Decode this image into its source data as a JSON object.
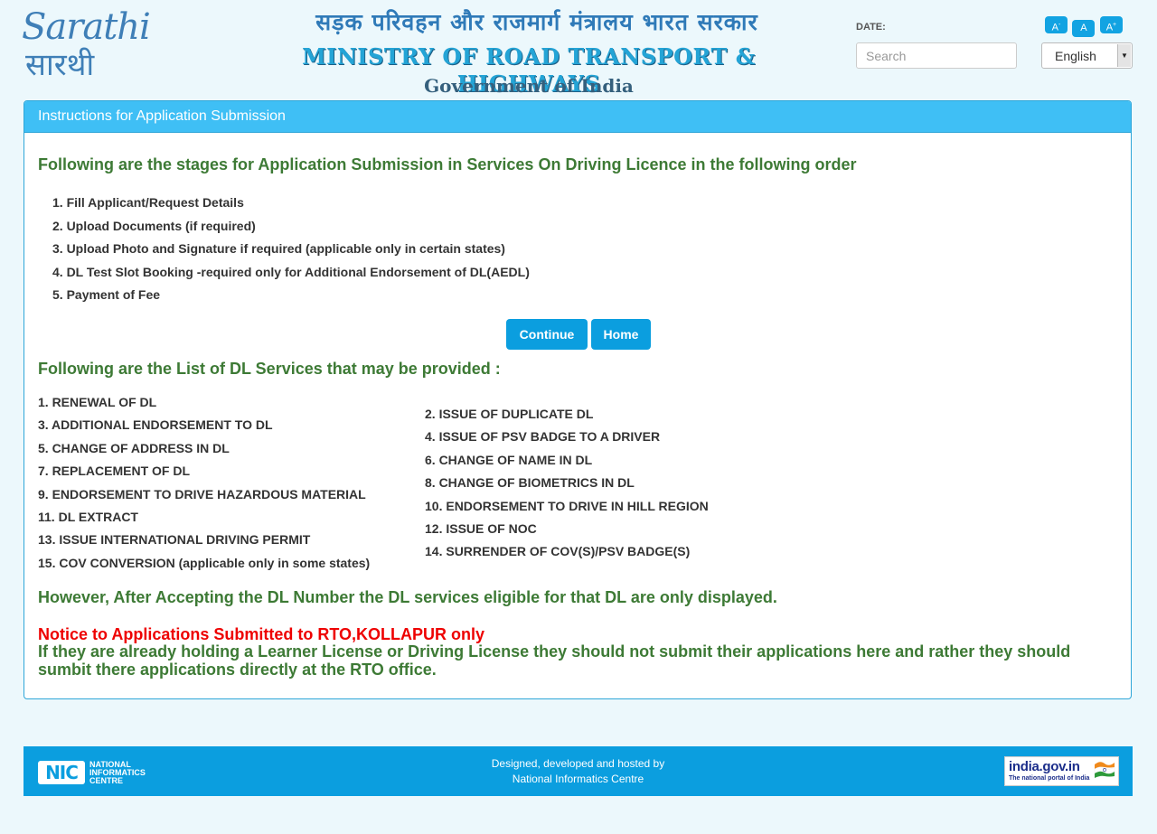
{
  "header": {
    "logo_top": "Sarathi",
    "logo_bottom": "सारथी",
    "ministry_hindi": "सड़क परिवहन और राजमार्ग मंत्रालय भारत सरकार",
    "ministry_english": "MINISTRY OF ROAD TRANSPORT & HIGHWAYS",
    "ministry_gov": "Government of India",
    "date_label": "DATE:",
    "search_placeholder": "Search",
    "font_small": "A-",
    "font_normal": "A",
    "font_large": "A+",
    "language": "English"
  },
  "panel": {
    "title": "Instructions for Application Submission",
    "stages_heading": "Following are the stages for Application Submission in Services On Driving Licence in the following order",
    "stages": [
      "1. Fill Applicant/Request Details",
      "2. Upload Documents (if required)",
      "3. Upload Photo and Signature if required (applicable only in certain states)",
      "4. DL Test Slot Booking -required only for Additional Endorsement of DL(AEDL)",
      "5. Payment of Fee"
    ],
    "continue_label": "Continue",
    "home_label": "Home",
    "services_heading": "Following are the List of DL Services that may be provided :",
    "services_left": [
      "1.  RENEWAL OF DL",
      "3.  ADDITIONAL ENDORSEMENT TO DL",
      "5.  CHANGE OF ADDRESS IN DL",
      "7.  REPLACEMENT OF DL",
      "9.  ENDORSEMENT TO DRIVE HAZARDOUS MATERIAL",
      "11. DL EXTRACT",
      "13. ISSUE INTERNATIONAL DRIVING PERMIT",
      "15. COV CONVERSION (applicable only in some states)"
    ],
    "services_right": [
      "2.  ISSUE OF DUPLICATE DL",
      "4.  ISSUE OF PSV BADGE TO A DRIVER",
      "6.  CHANGE OF NAME IN DL",
      "8.  CHANGE OF BIOMETRICS IN DL",
      "10. ENDORSEMENT TO DRIVE IN HILL REGION",
      "12. ISSUE OF NOC",
      "14. SURRENDER OF COV(S)/PSV BADGE(S)"
    ],
    "eligibility_note": "However, After Accepting the DL Number the DL services eligible for that DL are only displayed.",
    "notice_title": "Notice to Applications Submitted to RTO,KOLLAPUR only",
    "notice_body": "If they are already holding a Learner License or Driving License they should not submit their applications here and rather they should sumbit there applications directly at the RTO office."
  },
  "footer": {
    "nic_mark": "NIC",
    "nic_line1": "NATIONAL",
    "nic_line2": "INFORMATICS",
    "nic_line3": "CENTRE",
    "credit_line1": "Designed, developed and hosted by",
    "credit_line2": "National Informatics Centre",
    "portal_name": "india.gov.in",
    "portal_tagline": "The national portal of India"
  },
  "colors": {
    "accent": "#0b9edf",
    "panel_heading": "#3fbff5",
    "heading_green": "#3d7a35",
    "notice_red": "#ee0000"
  }
}
